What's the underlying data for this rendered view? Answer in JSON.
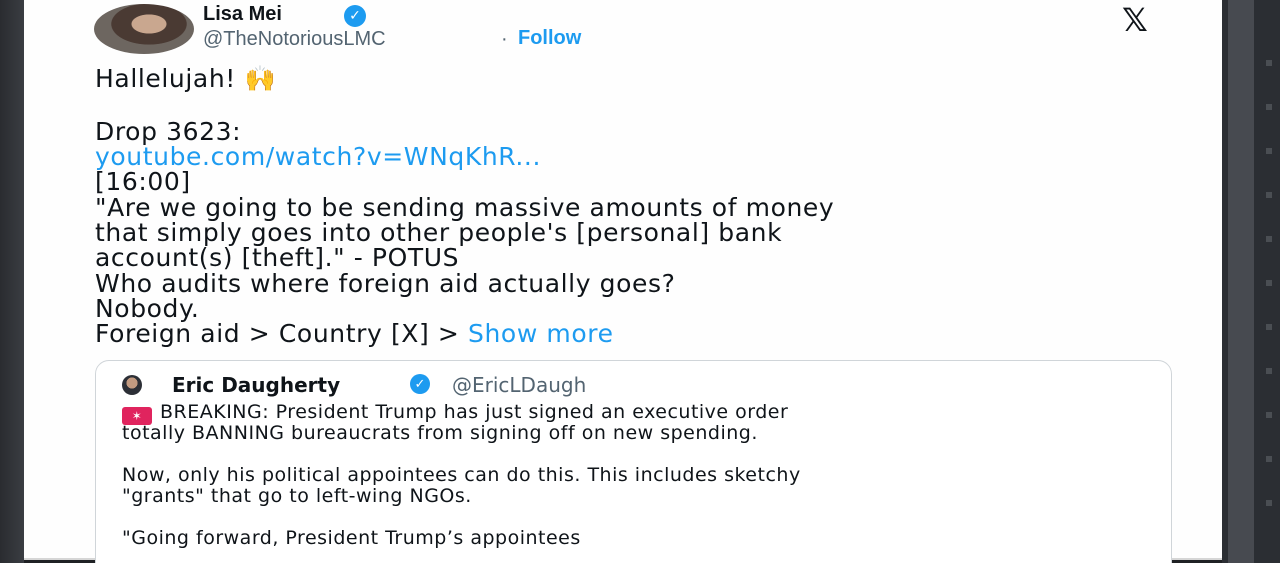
{
  "tweet": {
    "author_name": "Lisa Mei",
    "handle": "@TheNotoriousLMC",
    "separator": "·",
    "follow_label": "Follow",
    "verified_glyph": "✓",
    "x_logo_glyph": "𝕏",
    "lines": {
      "l1_text": "Hallelujah!",
      "l1_emoji": "🙌",
      "l2": "Drop 3623:",
      "l3_link": "youtube.com/watch?v=WNqKhR...",
      "l4": "[16:00]",
      "l5": "\"Are we going to be sending massive amounts of money",
      "l6": "that simply goes into other people's [personal] bank",
      "l7": "account(s) [theft].\" - POTUS",
      "l8": "Who audits where foreign aid actually goes?",
      "l9": "Nobody.",
      "l10_text": "Foreign aid > Country [X] >",
      "l10_more": "Show more"
    }
  },
  "quoted": {
    "author_name": "Eric Daugherty",
    "handle": "@EricLDaugh",
    "verified_glyph": "✓",
    "siren_glyph": "✶",
    "p1_l1": "BREAKING: President Trump has just signed an executive order",
    "p1_l2": "totally BANNING bureaucrats from signing off on new spending.",
    "p2_l1": "Now, only his political appointees can do this. This includes sketchy",
    "p2_l2": "\"grants\" that go to left-wing NGOs.",
    "p3_l1": "\"Going forward, President Trump’s appointees"
  },
  "colors": {
    "accent_blue": "#1d9bf0",
    "text_primary": "#0f1419",
    "text_secondary": "#536471"
  }
}
